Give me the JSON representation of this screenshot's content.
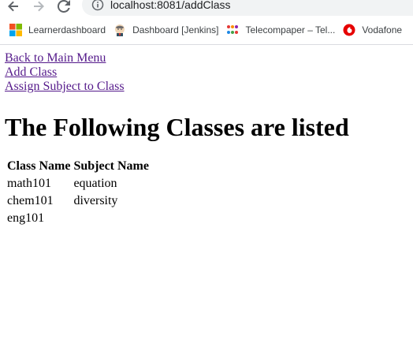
{
  "browser": {
    "url": "localhost:8081/addClass",
    "bookmarks": [
      {
        "label": "Learnerdashboard",
        "icon": "windows-logo-icon"
      },
      {
        "label": "Dashboard [Jenkins]",
        "icon": "jenkins-butler-icon"
      },
      {
        "label": "Telecompaper – Tel...",
        "icon": "telecompaper-dots-icon"
      },
      {
        "label": "Vodafone",
        "icon": "vodafone-logo-icon"
      }
    ]
  },
  "page": {
    "links": {
      "back": "Back to Main Menu",
      "add_class": "Add Class",
      "assign": "Assign Subject to Class"
    },
    "heading": "The Following Classes are listed",
    "table": {
      "headers": [
        "Class Name",
        "Subject Name"
      ],
      "rows": [
        [
          "math101",
          "equation"
        ],
        [
          "chem101",
          "diversity"
        ],
        [
          "eng101",
          ""
        ]
      ]
    }
  },
  "colors": {
    "link_visited": "#551a8b",
    "omnibox_bg": "#f1f3f4",
    "vodafone_red": "#e60000"
  }
}
